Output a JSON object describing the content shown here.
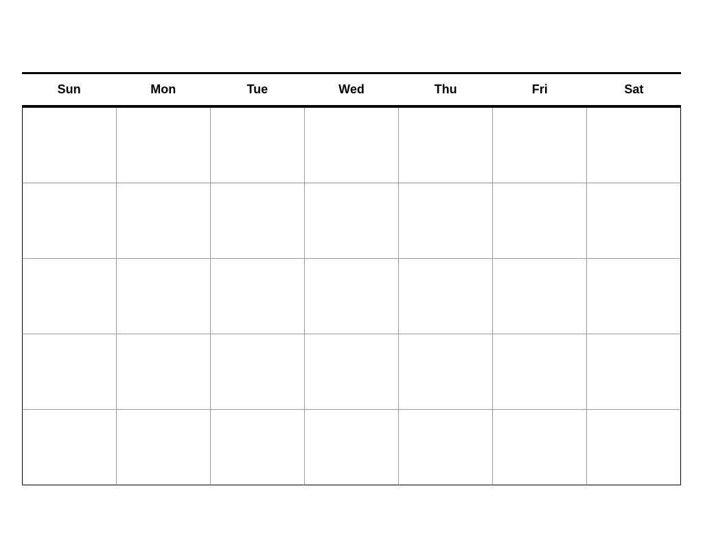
{
  "calendar": {
    "days": [
      {
        "label": "Sun"
      },
      {
        "label": "Mon"
      },
      {
        "label": "Tue"
      },
      {
        "label": "Wed"
      },
      {
        "label": "Thu"
      },
      {
        "label": "Fri"
      },
      {
        "label": "Sat"
      }
    ],
    "rows": 5,
    "cols": 7
  }
}
